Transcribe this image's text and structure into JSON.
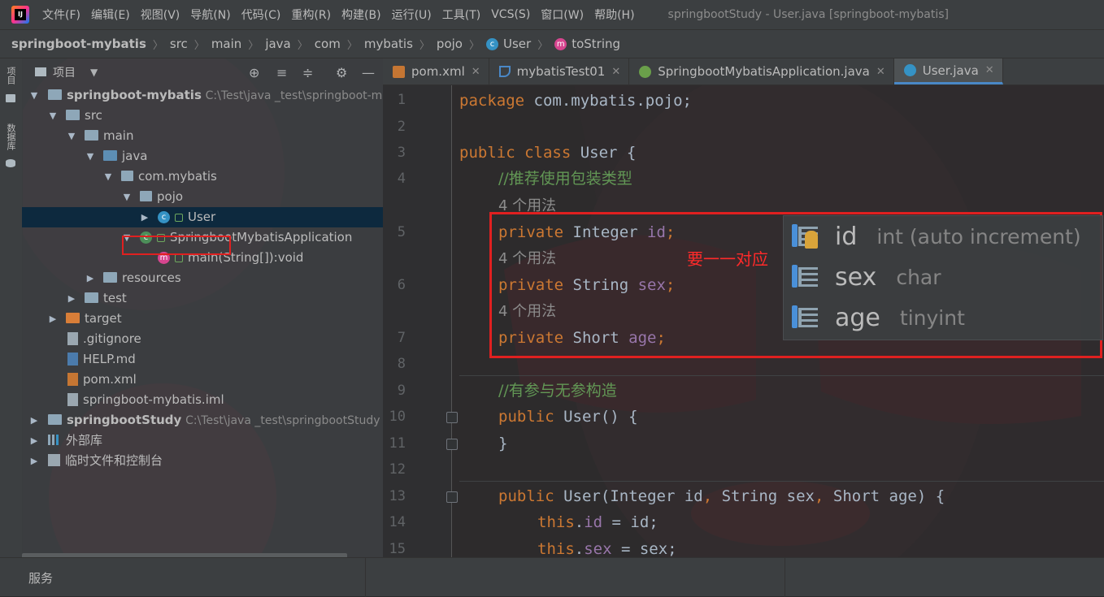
{
  "window": {
    "menus": [
      "文件(F)",
      "编辑(E)",
      "视图(V)",
      "导航(N)",
      "代码(C)",
      "重构(R)",
      "构建(B)",
      "运行(U)",
      "工具(T)",
      "VCS(S)",
      "窗口(W)",
      "帮助(H)"
    ],
    "title": "springbootStudy - User.java [springboot-mybatis]"
  },
  "breadcrumb": {
    "items": [
      "springboot-mybatis",
      "src",
      "main",
      "java",
      "com",
      "mybatis",
      "pojo"
    ],
    "class_name": "User",
    "method_name": "toString"
  },
  "side_strip": {
    "project_label": "项目",
    "database_label": "数据库"
  },
  "project_panel": {
    "title": "项目",
    "tree": [
      {
        "label": "springboot-mybatis",
        "hint": "C:\\Test\\java _test\\springboot-m"
      },
      {
        "label": "src"
      },
      {
        "label": "main"
      },
      {
        "label": "java"
      },
      {
        "label": "com.mybatis"
      },
      {
        "label": "pojo"
      },
      {
        "label": "User"
      },
      {
        "label": "SpringbootMybatisApplication"
      },
      {
        "label": "main(String[]):void"
      },
      {
        "label": "resources"
      },
      {
        "label": "test"
      },
      {
        "label": "target"
      },
      {
        "label": ".gitignore"
      },
      {
        "label": "HELP.md"
      },
      {
        "label": "pom.xml"
      },
      {
        "label": "springboot-mybatis.iml"
      },
      {
        "label": "springbootStudy",
        "hint": "C:\\Test\\java _test\\springbootStudy"
      },
      {
        "label": "外部库"
      },
      {
        "label": "临时文件和控制台"
      }
    ]
  },
  "tabs": [
    {
      "label": "pom.xml"
    },
    {
      "label": "mybatisTest01"
    },
    {
      "label": "SpringbootMybatisApplication.java"
    },
    {
      "label": "User.java"
    }
  ],
  "editor": {
    "line_numbers": [
      "1",
      "2",
      "3",
      "4",
      "5",
      "6",
      "7",
      "8",
      "9",
      "10",
      "11",
      "12",
      "13",
      "14",
      "15"
    ],
    "package_kw": "package",
    "package_name": " com.mybatis.pojo;",
    "public_kw": "public",
    "class_kw": " class ",
    "class_name": "User",
    "brace_open": " {",
    "comment_wrapper": "//推荐使用包装类型",
    "usages": "4 个用法",
    "private_kw": "private",
    "field_id_type": " Integer ",
    "field_id_name": "id",
    "field_sex_type": " String ",
    "field_sex_name": "sex",
    "field_age_type": " Short ",
    "field_age_name": "age",
    "semicolon": ";",
    "comment_ctor": "//有参与无参构造",
    "ctor_empty_sig": "() {",
    "brace_close": "}",
    "ctor_full_open": "(",
    "ctor_full_p1": "Integer id",
    "comma": ", ",
    "ctor_full_p2": "String sex",
    "ctor_full_p3": "Short age",
    "ctor_full_close": ") {",
    "this_kw": "this",
    "assign_id_field": "id",
    "assign_id_rhs": " = id;",
    "assign_sex_field": "sex",
    "assign_sex_rhs": " = sex;",
    "dot": "."
  },
  "annotation": {
    "text": "要一一对应",
    "color": "#e02020"
  },
  "db_columns": [
    {
      "name": "id",
      "type": "int (auto increment)",
      "icon": "primary-key-column-icon"
    },
    {
      "name": "sex",
      "type": "char",
      "icon": "column-icon"
    },
    {
      "name": "age",
      "type": "tinyint",
      "icon": "column-icon"
    }
  ],
  "statusbar": {
    "services": "服务"
  }
}
